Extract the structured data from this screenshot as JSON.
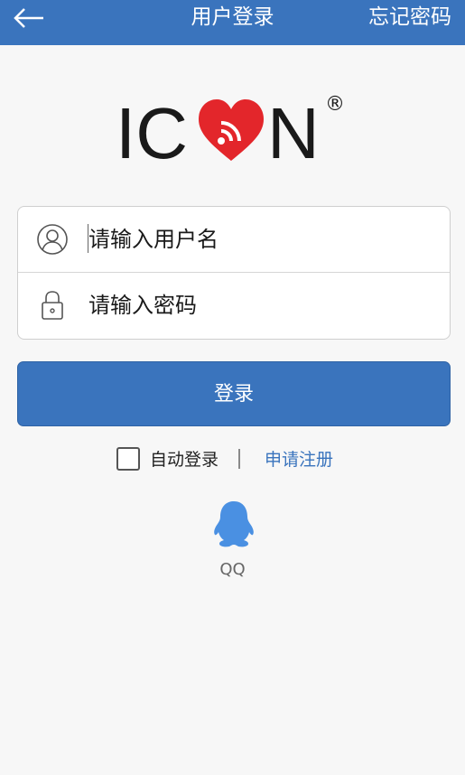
{
  "header": {
    "title": "用户登录",
    "forgot_password": "忘记密码",
    "back_icon": "back-arrow-icon"
  },
  "logo": {
    "text_left": "IC",
    "text_right": "N",
    "registered_mark": "®",
    "heart_icon": "heart-wifi-icon"
  },
  "form": {
    "username_placeholder": "请输入用户名",
    "password_placeholder": "请输入密码",
    "username_icon": "user-icon",
    "password_icon": "lock-icon"
  },
  "login_button": "登录",
  "options": {
    "auto_login": "自动登录",
    "auto_login_checked": false,
    "register": "申请注册"
  },
  "social": {
    "qq_icon": "qq-icon",
    "qq_label": "QQ"
  },
  "colors": {
    "primary": "#3a74bd",
    "logo_red": "#e3262b",
    "qq_blue": "#4a90e2",
    "background": "#f7f7f7"
  }
}
